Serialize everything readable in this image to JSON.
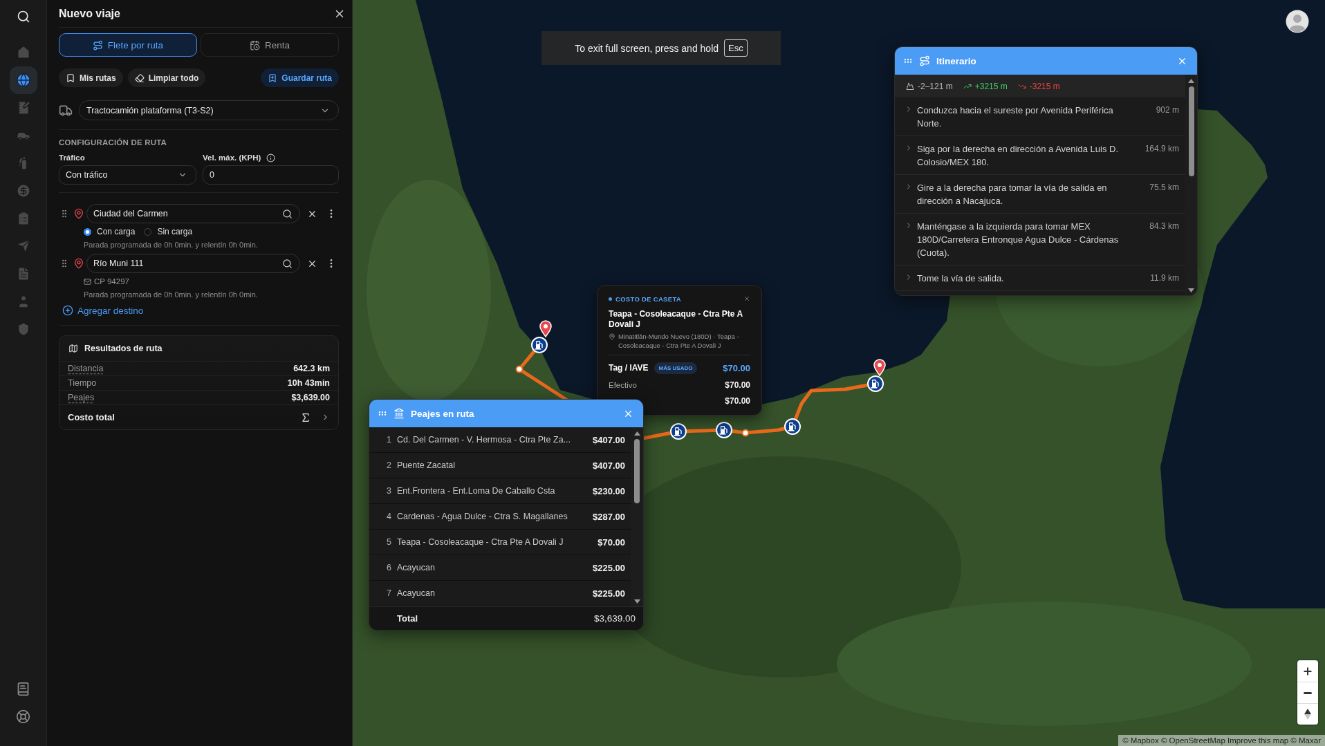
{
  "sidebar": {
    "items": [
      {
        "selected": false
      },
      {
        "selected": true
      },
      {
        "selected": false
      },
      {
        "selected": false
      },
      {
        "selected": false
      },
      {
        "selected": false
      },
      {
        "selected": false
      },
      {
        "selected": false
      },
      {
        "selected": false
      },
      {
        "selected": false
      },
      {
        "selected": false
      }
    ]
  },
  "trip_panel": {
    "title": "Nuevo viaje",
    "tabs": [
      {
        "label": "Flete por ruta",
        "selected": true
      },
      {
        "label": "Renta",
        "selected": false
      }
    ],
    "actions": [
      {
        "label": "Mis rutas",
        "kind": "plain"
      },
      {
        "label": "Limpiar todo",
        "kind": "plain"
      },
      {
        "label": "Guardar ruta",
        "kind": "primary"
      }
    ],
    "vehicle": {
      "value": "Tractocamión plataforma (T3-S2)"
    },
    "route_config": {
      "heading": "CONFIGURACIÓN DE RUTA",
      "traffic": {
        "label": "Tráfico",
        "value": "Con tráfico"
      },
      "max_speed": {
        "label": "Vel. máx. (KPH)",
        "value": "0"
      }
    },
    "stops": [
      {
        "value": "Ciudad del Carmen",
        "load_options": [
          {
            "label": "Con carga",
            "selected": true
          },
          {
            "label": "Sin carga",
            "selected": false
          }
        ],
        "note": "Parada programada de 0h 0min. y relentín 0h 0min."
      },
      {
        "value": "Río Muni 111",
        "postal_code": "CP 94297",
        "note": "Parada programada de 0h 0min. y relentín 0h 0min."
      }
    ],
    "add_stop": "Agregar destino",
    "results": {
      "title": "Resultados de ruta",
      "rows": [
        {
          "label": "Distancia",
          "value": "642.3 km",
          "hint": true
        },
        {
          "label": "Tiempo",
          "value": "10h 43min",
          "hint": false
        },
        {
          "label": "Peajes",
          "value": "$3,639.00",
          "hint": true
        }
      ],
      "total_label": "Costo total"
    }
  },
  "map": {
    "fullscreen_notice": {
      "text": "To exit full screen, press and hold",
      "key": "Esc"
    },
    "attribution": "© Mapbox © OpenStreetMap Improve this map © Maxar"
  },
  "toll_cost_popup": {
    "label": "COSTO DE CASETA",
    "title": "Teapa - Cosoleacaque - Ctra Pte A Dovali J",
    "location": "Minatitlán-Mundo Nuevo (180D) · Teapa - Cosoleacaque - Ctra Pte A Dovali J",
    "rows": [
      {
        "kind": "featured",
        "label": "Tag / IAVE",
        "badge": "MÁS USADO",
        "value": "$70.00"
      },
      {
        "kind": "plain",
        "label": "Efectivo",
        "value": "$70.00"
      },
      {
        "kind": "plain",
        "value": "$70.00"
      }
    ]
  },
  "tolls_panel": {
    "title": "Peajes en ruta",
    "rows": [
      {
        "index": "1",
        "name": "Cd. Del Carmen - V. Hermosa - Ctra Pte Za...",
        "price": "$407.00"
      },
      {
        "index": "2",
        "name": "Puente Zacatal",
        "price": "$407.00"
      },
      {
        "index": "3",
        "name": "Ent.Frontera - Ent.Loma De Caballo Csta",
        "price": "$230.00"
      },
      {
        "index": "4",
        "name": "Cardenas - Agua Dulce - Ctra S. Magallanes",
        "price": "$287.00"
      },
      {
        "index": "5",
        "name": "Teapa - Cosoleacaque - Ctra Pte A Dovali J",
        "price": "$70.00"
      },
      {
        "index": "6",
        "name": "Acayucan",
        "price": "$225.00"
      },
      {
        "index": "7",
        "name": "Acayucan",
        "price": "$225.00"
      }
    ],
    "total_label": "Total",
    "total": "$3,639.00"
  },
  "itinerary": {
    "title": "Itinerario",
    "elevation": {
      "range": "-2–121 m",
      "gain": "+3215 m",
      "loss": "-3215 m"
    },
    "steps": [
      {
        "text": "Conduzca hacia el sureste por Avenida Periférica Norte.",
        "distance": "902 m"
      },
      {
        "text": "Siga por la derecha en dirección a Avenida Luis D. Colosio/MEX 180.",
        "distance": "164.9 km"
      },
      {
        "text": "Gire a la derecha para tomar la vía de salida en dirección a Nacajuca.",
        "distance": "75.5 km"
      },
      {
        "text": "Manténgase a la izquierda para tomar MEX 180D/Carretera Entronque Agua Dulce - Cárdenas (Cuota).",
        "distance": "84.3 km"
      },
      {
        "text": "Tome la vía de salida.",
        "distance": "11.9 km"
      }
    ]
  }
}
